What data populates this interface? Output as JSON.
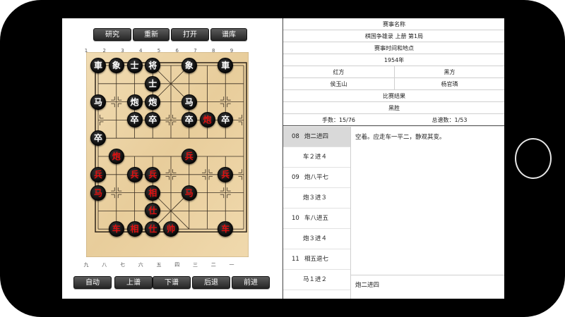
{
  "toolbar_top": [
    "研究",
    "重新",
    "打开",
    "谱库"
  ],
  "toolbar_bottom": [
    "自动",
    "上谱",
    "下谱",
    "后退",
    "前进"
  ],
  "top_coords": [
    "1",
    "2",
    "3",
    "4",
    "5",
    "6",
    "7",
    "8",
    "9"
  ],
  "bottom_coords": [
    "九",
    "八",
    "七",
    "六",
    "五",
    "四",
    "三",
    "二",
    "一"
  ],
  "pieces": [
    {
      "side": "black",
      "char": "車",
      "col": 0,
      "row": 0
    },
    {
      "side": "black",
      "char": "象",
      "col": 1,
      "row": 0
    },
    {
      "side": "black",
      "char": "士",
      "col": 2,
      "row": 0
    },
    {
      "side": "black",
      "char": "将",
      "col": 3,
      "row": 0
    },
    {
      "side": "black",
      "char": "象",
      "col": 5,
      "row": 0
    },
    {
      "side": "black",
      "char": "車",
      "col": 7,
      "row": 0
    },
    {
      "side": "black",
      "char": "士",
      "col": 3,
      "row": 1
    },
    {
      "side": "black",
      "char": "马",
      "col": 0,
      "row": 2
    },
    {
      "side": "black",
      "char": "炮",
      "col": 2,
      "row": 2
    },
    {
      "side": "black",
      "char": "炮",
      "col": 3,
      "row": 2
    },
    {
      "side": "black",
      "char": "马",
      "col": 5,
      "row": 2
    },
    {
      "side": "black",
      "char": "卒",
      "col": 2,
      "row": 3
    },
    {
      "side": "black",
      "char": "卒",
      "col": 3,
      "row": 3
    },
    {
      "side": "black",
      "char": "卒",
      "col": 5,
      "row": 3
    },
    {
      "side": "red",
      "char": "炮",
      "col": 6,
      "row": 3
    },
    {
      "side": "black",
      "char": "卒",
      "col": 7,
      "row": 3
    },
    {
      "side": "black",
      "char": "卒",
      "col": 0,
      "row": 4
    },
    {
      "side": "red",
      "char": "炮",
      "col": 1,
      "row": 5
    },
    {
      "side": "red",
      "char": "兵",
      "col": 5,
      "row": 5
    },
    {
      "side": "red",
      "char": "兵",
      "col": 0,
      "row": 6
    },
    {
      "side": "red",
      "char": "兵",
      "col": 2,
      "row": 6
    },
    {
      "side": "red",
      "char": "兵",
      "col": 3,
      "row": 6
    },
    {
      "side": "red",
      "char": "兵",
      "col": 7,
      "row": 6
    },
    {
      "side": "red",
      "char": "马",
      "col": 0,
      "row": 7
    },
    {
      "side": "red",
      "char": "相",
      "col": 3,
      "row": 7
    },
    {
      "side": "red",
      "char": "马",
      "col": 5,
      "row": 7
    },
    {
      "side": "red",
      "char": "仕",
      "col": 3,
      "row": 8
    },
    {
      "side": "red",
      "char": "车",
      "col": 1,
      "row": 9
    },
    {
      "side": "red",
      "char": "相",
      "col": 2,
      "row": 9
    },
    {
      "side": "red",
      "char": "仕",
      "col": 3,
      "row": 9
    },
    {
      "side": "red",
      "char": "帅",
      "col": 4,
      "row": 9
    },
    {
      "side": "red",
      "char": "车",
      "col": 7,
      "row": 9
    }
  ],
  "info": {
    "event_label": "赛事名称",
    "event_value": "棋国争雄录 上册 第1局",
    "time_place_label": "赛事时间和地点",
    "time_place_value": "1954年",
    "red_label": "红方",
    "black_label": "黑方",
    "red_player": "侯玉山",
    "black_player": "杨官璘",
    "result_label": "比赛结果",
    "result_value": "黑胜",
    "move_count": "手数：15/76",
    "total_games": "总谱数：1/53"
  },
  "moves": [
    {
      "num": "08",
      "text": "炮二进四",
      "selected": true
    },
    {
      "num": "",
      "text": "车２进４",
      "selected": false
    },
    {
      "num": "09",
      "text": "炮八平七",
      "selected": false
    },
    {
      "num": "",
      "text": "炮３进３",
      "selected": false
    },
    {
      "num": "10",
      "text": "车八进五",
      "selected": false
    },
    {
      "num": "",
      "text": "炮３进４",
      "selected": false
    },
    {
      "num": "11",
      "text": "相五退七",
      "selected": false
    },
    {
      "num": "",
      "text": "马１进２",
      "selected": false
    }
  ],
  "comment": "空着。应走车一平二，静观其变。",
  "current_move": "炮二进四"
}
